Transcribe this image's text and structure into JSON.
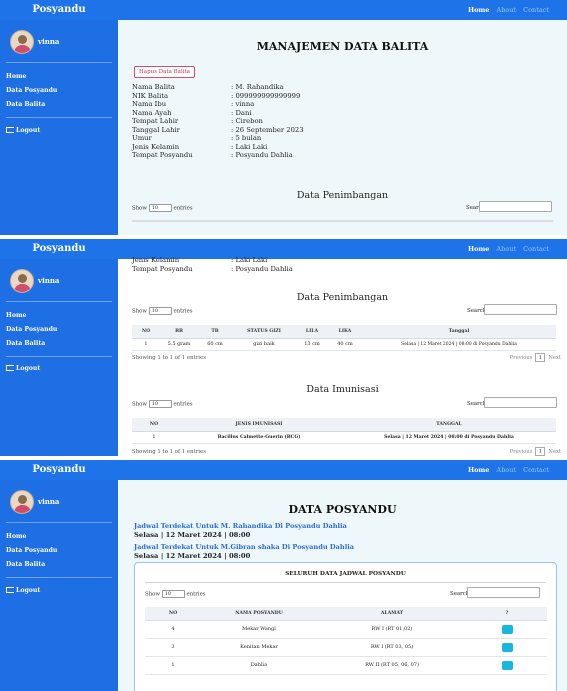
{
  "nav": {
    "brand": "Posyandu",
    "home": "Home",
    "about": "About",
    "contact": "Contact"
  },
  "sidebar": {
    "user": "vinna",
    "items": [
      "Home",
      "Data Posyandu",
      "Data Balita"
    ],
    "logout": "Logout"
  },
  "balita": {
    "title": "MANAJEMEN DATA BALITA",
    "delete_button": "Hapus Data Balita",
    "fields": [
      {
        "k": "Nama Balita",
        "v": ": M. Rahandika"
      },
      {
        "k": "NIK Balita",
        "v": ": 099999999999999"
      },
      {
        "k": "Nama Ibu",
        "v": ": vinna"
      },
      {
        "k": "Nama Ayah",
        "v": ": Dani"
      },
      {
        "k": "Tempat Lahir",
        "v": ": Cirebon"
      },
      {
        "k": "Tanggal Lahir",
        "v": ": 26 September 2023"
      },
      {
        "k": "Umur",
        "v": ": 5 bulan"
      },
      {
        "k": "Jenis Kelamin",
        "v": ": Laki Laki"
      },
      {
        "k": "Tempat Posyandu",
        "v": ": Posyandu Dahlia"
      }
    ],
    "partial_fields": [
      {
        "k": "Jenis Kelamin",
        "v": ": Laki Laki"
      },
      {
        "k": "Tempat Posyandu",
        "v": ": Posyandu Dahlia"
      }
    ]
  },
  "table_common": {
    "show": "Show",
    "entries": "entries",
    "entries_value": "10",
    "search": "Search:",
    "previous": "Previous",
    "page": "1",
    "next": "Next"
  },
  "penimbangan": {
    "title": "Data Penimbangan",
    "columns": [
      "NO",
      "BB",
      "TB",
      "STATUS GIZI",
      "LILA",
      "LIKA",
      "Tanggal"
    ],
    "rows": [
      [
        "1",
        "5.5 gram",
        "60 cm",
        "gizi baik",
        "13 cm",
        "40 cm",
        "Selasa | 12 Maret 2024 | 08:00 di Posyandu Dahlia"
      ]
    ],
    "info": "Showing 1 to 1 of 1 entries"
  },
  "imunisasi": {
    "title": "Data Imunisasi",
    "columns": [
      "NO",
      "JENIS IMUNISASI",
      "TANGGAL"
    ],
    "rows": [
      [
        "1",
        "Bacillus Calmette-Guerin (BCG)",
        "Selasa | 12 Maret 2024 | 08:00 di Posyandu Dahlia"
      ]
    ],
    "info": "Showing 1 to 1 of 1 entries"
  },
  "posyandu": {
    "title": "DATA POSYANDU",
    "link1": "Jadwal Terdekat Untuk M. Rahandika Di Posyandu Dahlia",
    "sched1": "Selasa | 12 Maret 2024 | 08:00",
    "link2": "Jadwal Terdekat Untuk M.Gibran shaka Di Posyandu Dahlia",
    "sched2": "Selasa | 12 Maret 2024 | 08:00",
    "card_title": "SELURUH DATA JADWAL POSYANDU",
    "columns": [
      "NO",
      "NAMA POSYANDU",
      "ALAMAT",
      "?"
    ],
    "rows": [
      [
        "4",
        "Mekar Wangi",
        "RW I (RT 01,02)"
      ],
      [
        "3",
        "Kenitan Mekar",
        "RW I (RT 03, 05)"
      ],
      [
        "1",
        "Dahlia",
        "RW II (RT 05, 06, 07)"
      ]
    ]
  },
  "colors": {
    "primary": "#1e73e8",
    "content_bg": "#eef8fb",
    "danger": "#c73459",
    "action": "#18b7df"
  }
}
